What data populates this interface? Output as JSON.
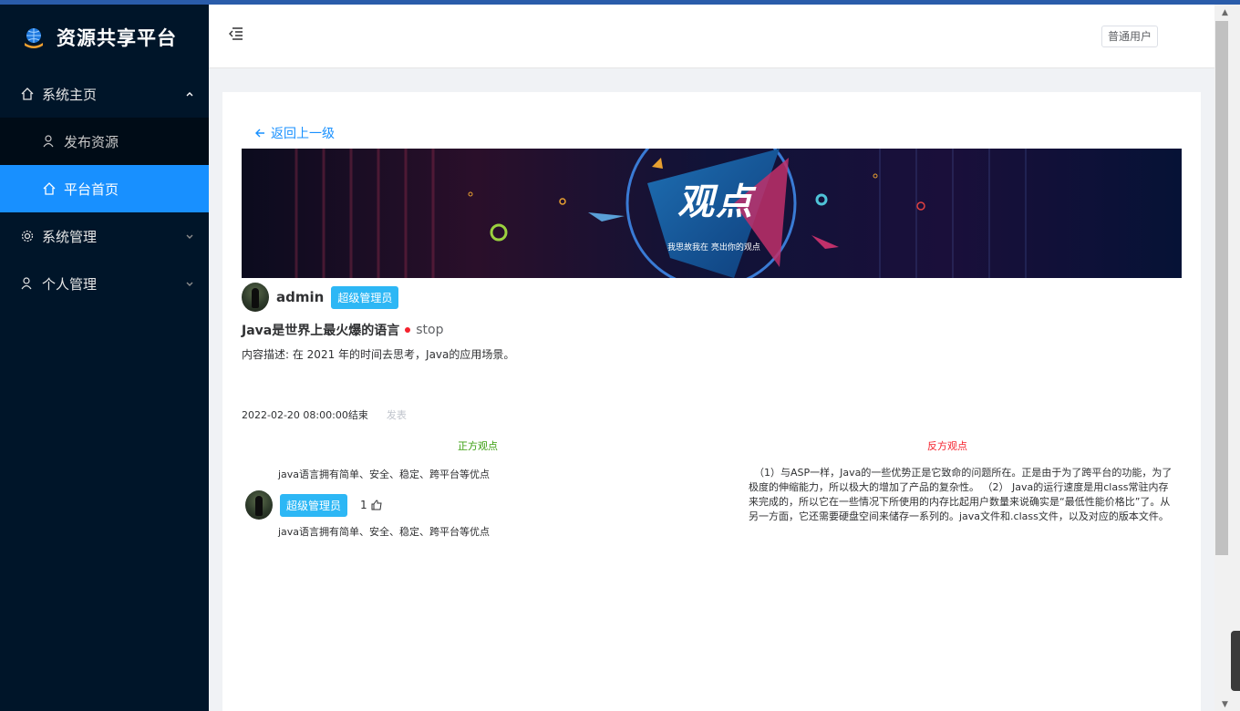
{
  "app": {
    "title": "资源共享平台"
  },
  "sidebar": {
    "groups": [
      {
        "label": "系统主页",
        "expanded": true,
        "items": [
          {
            "label": "发布资源",
            "active": false
          },
          {
            "label": "平台首页",
            "active": true
          }
        ]
      },
      {
        "label": "系统管理",
        "expanded": false
      },
      {
        "label": "个人管理",
        "expanded": false
      }
    ]
  },
  "header": {
    "user_label": "普通用户"
  },
  "page": {
    "back_label": "返回上一级",
    "banner": {
      "title": "观点",
      "subtitle": "我思故我在 亮出你的观点"
    },
    "author": {
      "name": "admin",
      "role": "超级管理员"
    },
    "topic": {
      "title": "Java是世界上最火爆的语言",
      "status": "stop"
    },
    "description": "内容描述: 在 2021 年的时间去思考，Java的应用场景。",
    "end_time": "2022-02-20 08:00:00结束",
    "publish_label": "发表",
    "pro": {
      "title": "正方观点",
      "summary": "java语言拥有简单、安全、稳定、跨平台等优点",
      "comment": {
        "role": "超级管理员",
        "likes": "1",
        "text": "java语言拥有简单、安全、稳定、跨平台等优点"
      }
    },
    "con": {
      "title": "反方观点",
      "text": "（1）与ASP一样，Java的一些优势正是它致命的问题所在。正是由于为了跨平台的功能，为了极度的伸缩能力，所以极大的增加了产品的复杂性。 （2） Java的运行速度是用class常驻内存来完成的，所以它在一些情况下所使用的内存比起用户数量来说确实是“最低性能价格比”了。从另一方面，它还需要硬盘空间来储存一系列的。java文件和.class文件，以及对应的版本文件。"
    }
  },
  "colors": {
    "sidebar_bg": "#001529",
    "active": "#1890ff",
    "tag": "#2db7f5",
    "pro": "#389e0d",
    "con": "#f5222d"
  },
  "icons": [
    "globe-logo-icon",
    "home-icon",
    "user-icon",
    "gear-icon",
    "menu-fold-icon",
    "arrow-left-icon",
    "thumbs-up-icon"
  ]
}
